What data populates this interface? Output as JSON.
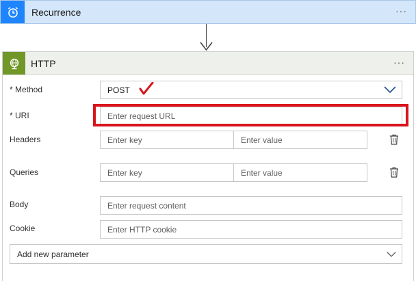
{
  "recurrence": {
    "title": "Recurrence",
    "menu": "···"
  },
  "http": {
    "title": "HTTP",
    "menu": "···",
    "method": {
      "label": "* Method",
      "value": "POST"
    },
    "uri": {
      "label": "* URI",
      "placeholder": "Enter request URL"
    },
    "headers": {
      "label": "Headers",
      "key_placeholder": "Enter key",
      "value_placeholder": "Enter value"
    },
    "queries": {
      "label": "Queries",
      "key_placeholder": "Enter key",
      "value_placeholder": "Enter value"
    },
    "body": {
      "label": "Body",
      "placeholder": "Enter request content"
    },
    "cookie": {
      "label": "Cookie",
      "placeholder": "Enter HTTP cookie"
    },
    "add_parameter": "Add new parameter"
  },
  "colors": {
    "recurrence_header": "#d4e6f9",
    "recurrence_icon_bg": "#1f85ff",
    "http_icon_bg": "#709727",
    "highlight": "#d9141c",
    "checkmark": "#d9141c"
  },
  "icons": [
    "alarm-clock-icon",
    "globe-icon",
    "more-icon",
    "chevron-down-icon",
    "trash-icon",
    "down-arrow-icon",
    "checkmark-icon"
  ]
}
